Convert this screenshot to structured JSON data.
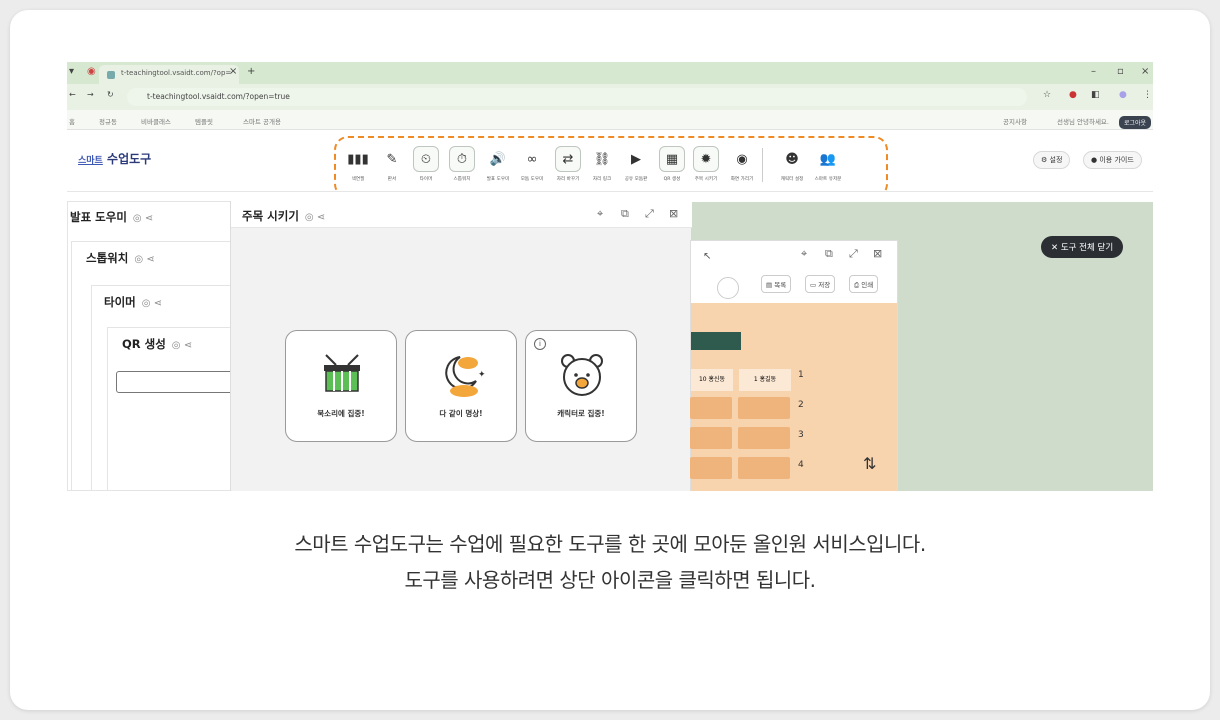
{
  "browser": {
    "tab_title": "t-teachingtool.vsaidt.com/?op=",
    "url": "t-teachingtool.vsaidt.com/?open=true",
    "bookmarks": [
      "홈",
      "정규동",
      "비바클래스",
      "템플릿",
      "스마트 공개용"
    ],
    "bookmark_right": [
      "공지사항",
      "선생님 안녕하세요."
    ],
    "login_label": "로그아웃"
  },
  "app": {
    "logo_prefix": "스마트",
    "logo_main": "수업도구",
    "tools": [
      {
        "label": "색연필",
        "icon": "pencils-icon",
        "glyph": "▮▮▮"
      },
      {
        "label": "판서",
        "icon": "board-icon",
        "glyph": "✎"
      },
      {
        "label": "타이머",
        "icon": "timer-icon",
        "glyph": "⏲"
      },
      {
        "label": "스톱워치",
        "icon": "stopwatch-icon",
        "glyph": "⏱"
      },
      {
        "label": "발표 도우미",
        "icon": "speaker-icon",
        "glyph": "🔊"
      },
      {
        "label": "모둠 도우미",
        "icon": "group-icon",
        "glyph": "∞"
      },
      {
        "label": "자리 바꾸기",
        "icon": "seat-icon",
        "glyph": "⇄"
      },
      {
        "label": "자리 링크",
        "icon": "link-icon",
        "glyph": "⛓"
      },
      {
        "label": "공유 모둠판",
        "icon": "share-board-icon",
        "glyph": "▶"
      },
      {
        "label": "QR 생성",
        "icon": "qr-icon",
        "glyph": "▦"
      },
      {
        "label": "주목 시키기",
        "icon": "attention-icon",
        "glyph": "✹"
      },
      {
        "label": "화면 가리기",
        "icon": "hide-screen-icon",
        "glyph": "◉"
      },
      {
        "label": "캐릭터 설정",
        "icon": "character-icon",
        "glyph": "☻"
      },
      {
        "label": "스마트 유저분",
        "icon": "users-icon",
        "glyph": "👥"
      }
    ],
    "settings_label": "설정",
    "guide_label": "이용 가이드"
  },
  "panels": {
    "presentation": "발표 도우미",
    "stopwatch": "스톱워치",
    "timer": "타이머",
    "qr": "QR 생성",
    "focus": "주목 시키기",
    "close_all": "도구 전체 닫기"
  },
  "focus_cards": [
    {
      "label": "북소리에 집중!",
      "icon": "drum-icon"
    },
    {
      "label": "다 같이 명상!",
      "icon": "moon-cloud-icon"
    },
    {
      "label": "캐릭터로 집중!",
      "icon": "bear-icon"
    }
  ],
  "seating": {
    "buttons": [
      "목록",
      "저장",
      "인쇄"
    ],
    "headers": [
      "10 홍신동",
      "1 홍길동"
    ],
    "rows": [
      "1",
      "2",
      "3",
      "4"
    ]
  },
  "caption": {
    "line1": "스마트 수업도구는 수업에 필요한 도구를 한 곳에 모아둔  올인원 서비스입니다.",
    "line2": "도구를 사용하려면 상단 아이콘을 클릭하면 됩니다."
  },
  "colors": {
    "accent": "#f08a24",
    "tab_bar": "#d6e8cf",
    "seat_bg": "#f7d3ae"
  }
}
